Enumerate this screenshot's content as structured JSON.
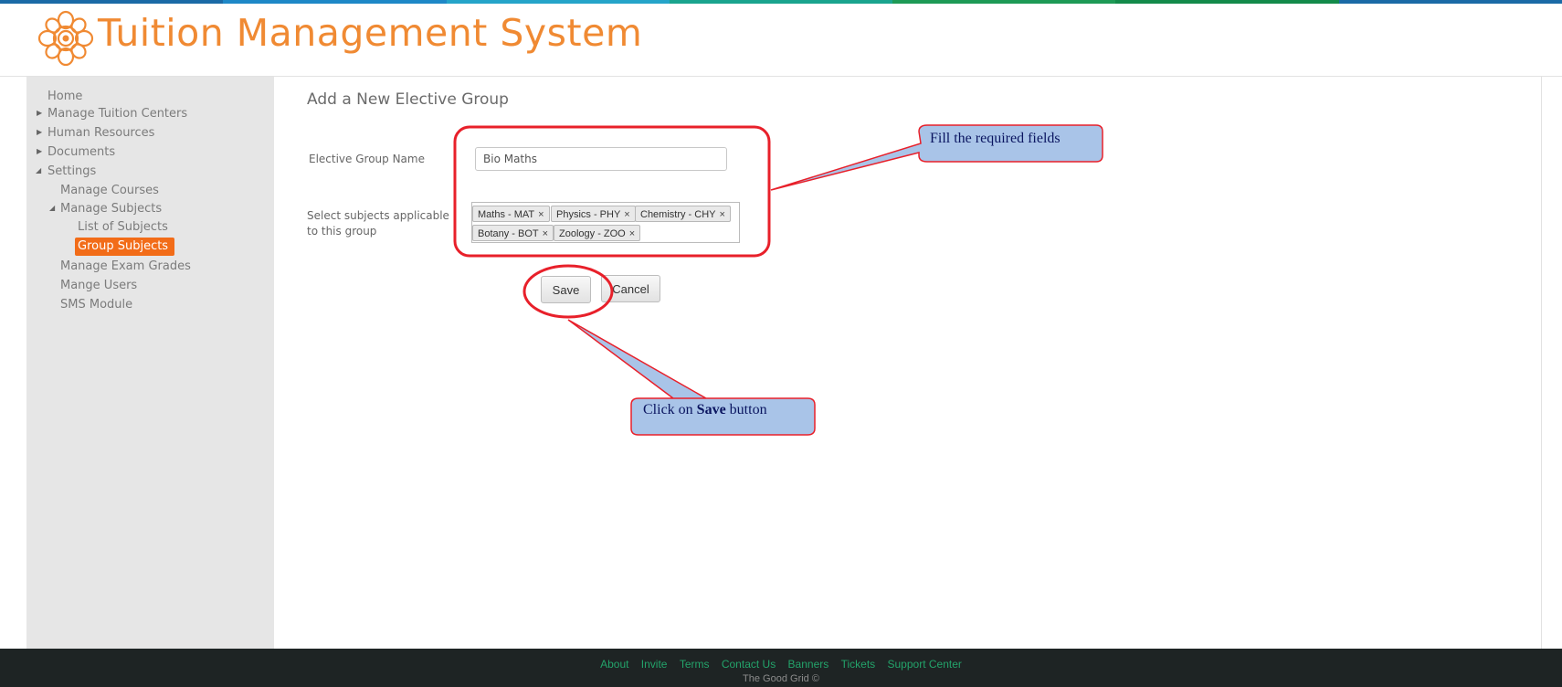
{
  "header": {
    "app_title": "Tuition Management System"
  },
  "sidebar": {
    "home": "Home",
    "manage_tuition_centers": "Manage Tuition Centers",
    "human_resources": "Human Resources",
    "documents": "Documents",
    "settings": "Settings",
    "manage_courses": "Manage Courses",
    "manage_subjects": "Manage Subjects",
    "list_of_subjects": "List of Subjects",
    "group_subjects": "Group Subjects",
    "manage_exam_grades": "Manage Exam Grades",
    "mange_users": "Mange Users",
    "sms_module": "SMS Module"
  },
  "form": {
    "title": "Add a New Elective Group",
    "group_name_label": "Elective Group Name",
    "group_name_value": "Bio Maths",
    "subjects_label_line1": "Select subjects applicable",
    "subjects_label_line2": "to this group",
    "selected_subjects": [
      "Maths - MAT",
      "Physics - PHY",
      "Chemistry - CHY",
      "Botany - BOT",
      "Zoology - ZOO"
    ],
    "remove_symbol": "×",
    "save_label": "Save",
    "cancel_label": "Cancel"
  },
  "callouts": {
    "fill_fields": "Fill the required fields",
    "click_save_prefix": "Click on ",
    "click_save_bold": "Save",
    "click_save_suffix": " button"
  },
  "footer": {
    "links": [
      "About",
      "Invite",
      "Terms",
      "Contact Us",
      "Banners",
      "Tickets",
      "Support Center"
    ],
    "copyright": "The Good Grid ©"
  },
  "colors": {
    "brand_orange": "#f08a33",
    "active_nav": "#f26c18",
    "footer_bg": "#1e2424",
    "footer_link": "#23a36a",
    "annotation_red": "#e8202a",
    "callout_fill": "#a9c4e8"
  }
}
